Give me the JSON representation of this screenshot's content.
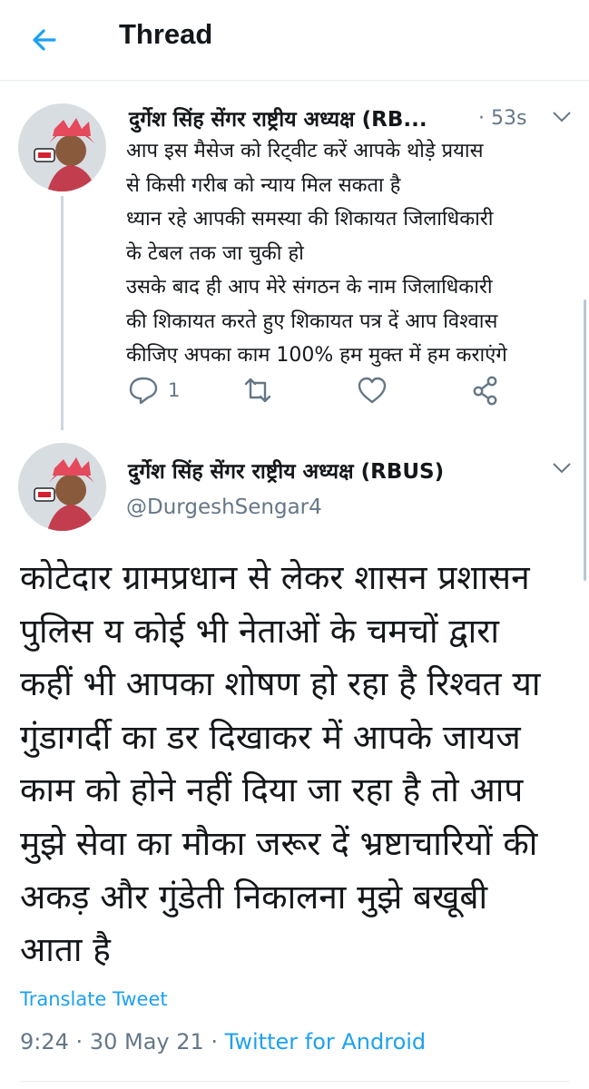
{
  "header": {
    "title": "Thread"
  },
  "tweets": [
    {
      "author": "दुर्गेश सिंह सेंगर राष्ट्रीय अध्यक्ष (RB...",
      "time": "53s",
      "lines": [
        "आप इस मैसेज को रिट्वीट करें आपके थोड़े प्रयास",
        "से किसी गरीब को न्याय मिल सकता है",
        "ध्यान रहे आपकी समस्या की शिकायत जिलाधिकारी",
        "के टेबल तक जा चुकी हो",
        "उसके बाद ही आप मेरे संगठन के नाम जिलाधिकारी",
        "की शिकायत करते हुए शिकायत पत्र दें आप विश्वास",
        "कीजिए अपका काम 100% हम मुक्त में हम कराएंगे"
      ],
      "reply_count": "1"
    },
    {
      "author": "दुर्गेश सिंह सेंगर राष्ट्रीय अध्यक्ष (RBUS)",
      "handle": "@DurgeshSengar4",
      "lines": [
        "कोटेदार ग्रामप्रधान से लेकर शासन प्रशासन",
        "पुलिस य कोई भी नेताओं के चमचों द्वारा",
        "कहीं भी आपका शोषण हो रहा है रिश्वत या",
        "गुंडागर्दी का डर दिखाकर में आपके जायज",
        "काम को  होने नहीं दिया जा रहा है तो आप",
        "मुझे सेवा का मौका जरूर दें भ्रष्टाचारियों की",
        "अकड़ और गुंडेती निकालना मुझे बखूबी",
        "आता है"
      ],
      "translate_label": "Translate Tweet",
      "time": "9:24",
      "date": "30 May 21",
      "source": "Twitter for Android"
    }
  ],
  "colors": {
    "accent": "#1da1f2",
    "secondary_text": "#657786",
    "text": "#14171a",
    "divider": "#e6ecf0"
  },
  "icons": [
    "back-arrow-icon",
    "chevron-down-icon",
    "reply-icon",
    "retweet-icon",
    "like-icon",
    "share-icon"
  ]
}
